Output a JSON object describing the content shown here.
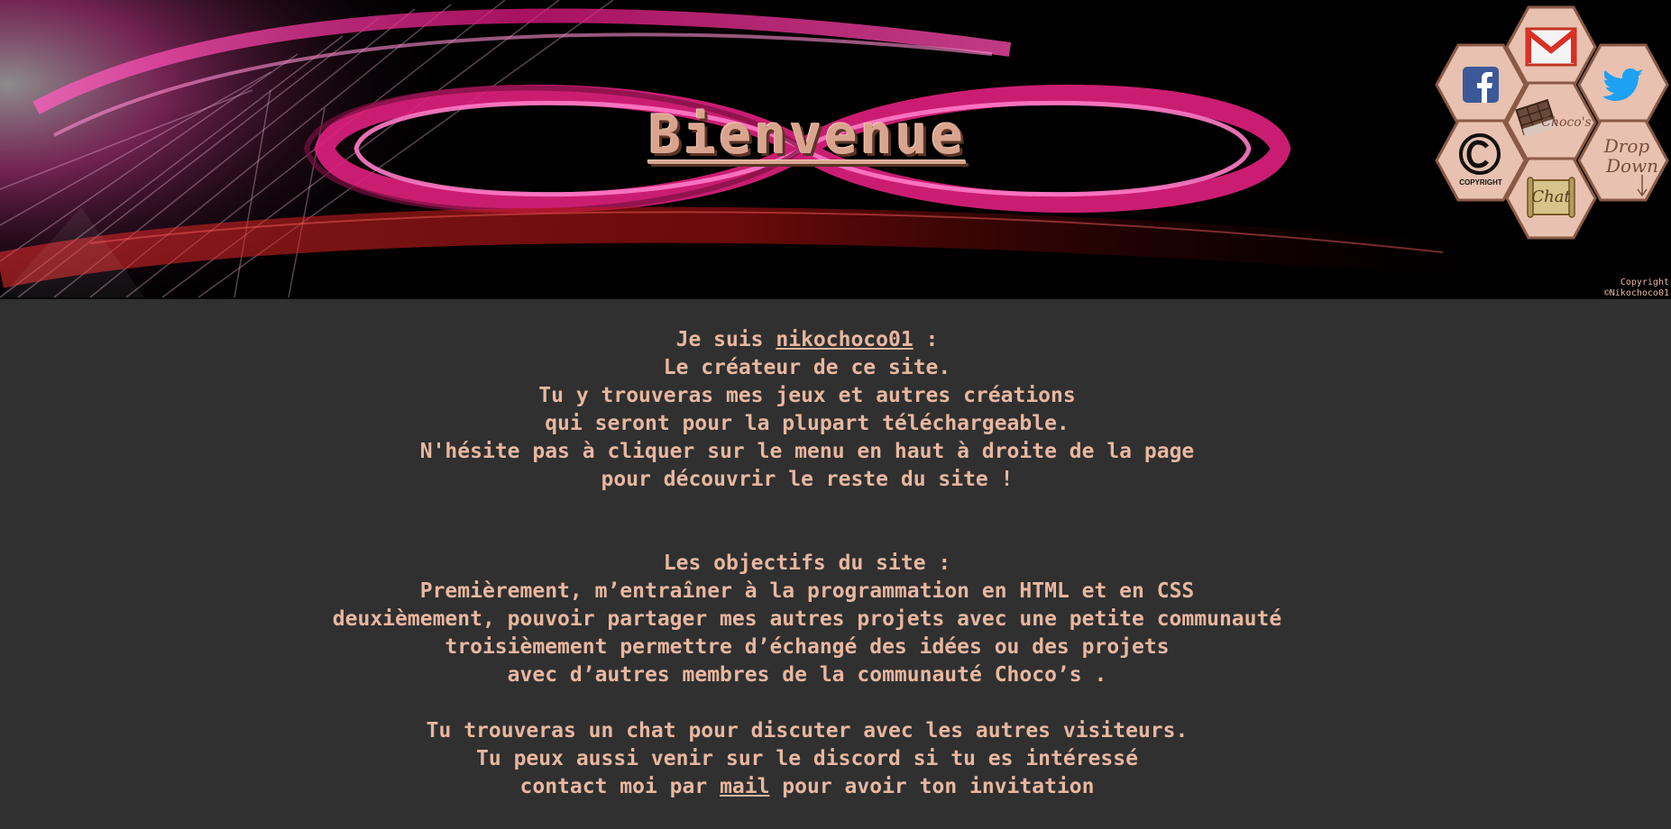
{
  "header": {
    "title": "Bienvenue",
    "copyright_line1": "Copyright",
    "copyright_line2": "©Nikochoco01"
  },
  "menu": {
    "gmail": "gmail-icon",
    "facebook": "facebook-icon",
    "twitter": "twitter-icon",
    "home_label": "Choco's",
    "copyright_label": "COPYRIGHT",
    "dropdown_line1": "Drop",
    "dropdown_line2": "Down",
    "chat_label": "Chat"
  },
  "intro": {
    "line1_prefix": "Je suis ",
    "line1_link": "nikochoco01",
    "line1_suffix": " :",
    "line2": "Le créateur de ce site.",
    "line3": "Tu y trouveras mes jeux et autres créations",
    "line4": "qui seront pour la plupart téléchargeable.",
    "line5": "N'hésite pas à cliquer sur le menu en haut à droite de la page",
    "line6": "pour découvrir le reste du site !"
  },
  "objectives": {
    "heading": "Les objectifs du site :",
    "line1": "Premièrement, m’entraîner à la programmation en HTML et en CSS",
    "line2": "deuxièmement, pouvoir partager mes autres projets avec une petite communauté",
    "line3": "troisièmement permettre d’échangé des idées ou des projets",
    "line4": "avec d’autres membres de la communauté Choco’s ."
  },
  "community": {
    "line1": "Tu trouveras un chat pour discuter avec les autres visiteurs.",
    "line2": "Tu peux aussi venir sur le discord si tu es intéressé"
  },
  "contact": {
    "prefix": "contact moi par ",
    "link": "mail",
    "suffix": " pour avoir ton invitation"
  },
  "colors": {
    "background": "#303030",
    "text": "#e8b7a0",
    "hex_fill": "#e8c1b0",
    "hex_border": "#8a5a48",
    "accent_pink": "#ff3fa8"
  }
}
